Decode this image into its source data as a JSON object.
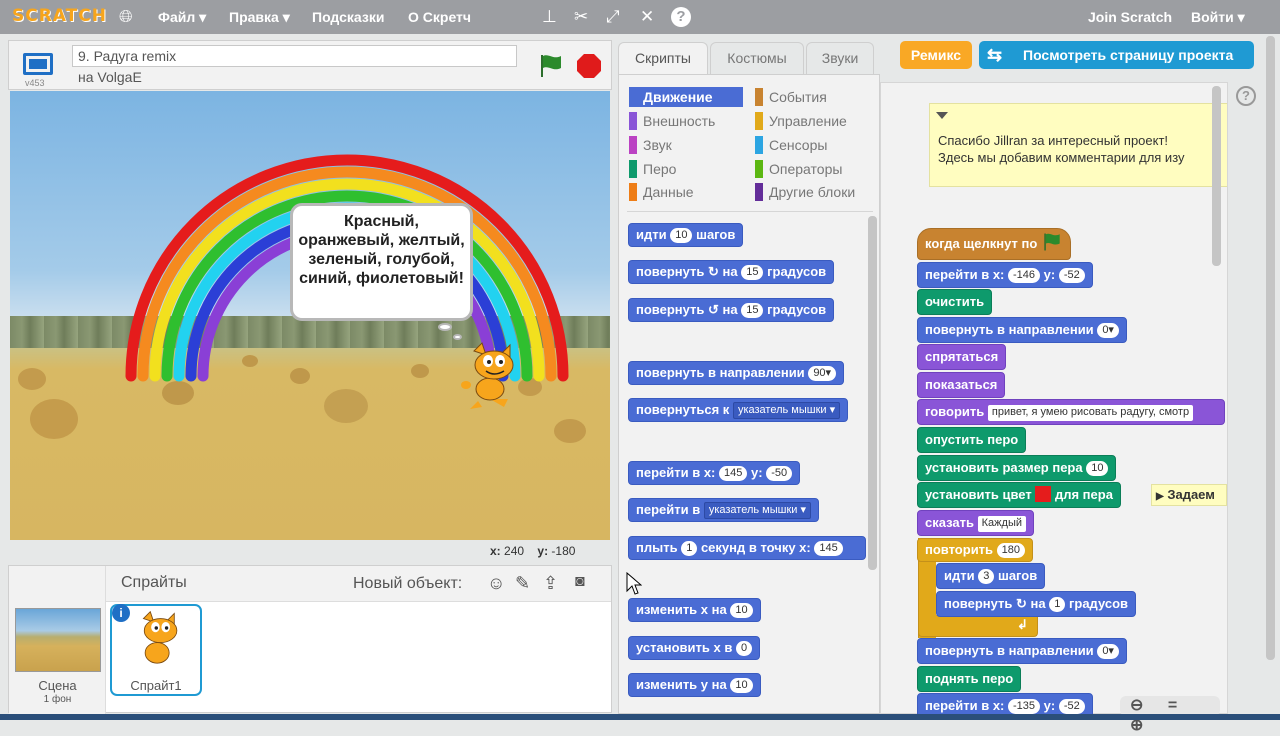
{
  "topbar": {
    "logo": "SCRATCH",
    "menus": [
      "Файл ▾",
      "Правка ▾",
      "Подсказки",
      "О Скретч"
    ],
    "join": "Join Scratch",
    "login": "Войти ▾",
    "tool_icons": [
      "globe-icon",
      "stamp-icon",
      "cut-icon",
      "grow-icon",
      "shrink-icon",
      "help-icon"
    ]
  },
  "stage": {
    "version": "v453",
    "project_title": "9. Радуга remix",
    "author": "на VolgaE",
    "bubble_text": "Красный, оранжевый, желтый, зеленый, голубой, синий, фиолетовый!",
    "coords_x_label": "x:",
    "coords_x": "240",
    "coords_y_label": "y:",
    "coords_y": "-180",
    "rainbow_colors": [
      "#e51c1c",
      "#f58a1f",
      "#f2e01e",
      "#2fbf2f",
      "#22d2f0",
      "#2b3fd6",
      "#8a3fd6"
    ],
    "flag_color": "#2c8a2c",
    "stop_color": "#e01b1b"
  },
  "sprites": {
    "header": "Спрайты",
    "new_object": "Новый объект:",
    "tools": [
      "☺",
      "✎",
      "⇪",
      "📷"
    ],
    "scene_label": "Сцена",
    "scene_sub": "1 фон",
    "sprite_label": "Спрайт1",
    "info_badge": "i"
  },
  "tabs": {
    "scripts": "Скрипты",
    "costumes": "Костюмы",
    "sounds": "Звуки",
    "remix": "Ремикс",
    "see_project": "Посмотреть страницу проекта"
  },
  "categories": {
    "left": [
      {
        "label": "Движение",
        "color": "#4a6cd4"
      },
      {
        "label": "Внешность",
        "color": "#8a55d7"
      },
      {
        "label": "Звук",
        "color": "#bb42c3"
      },
      {
        "label": "Перо",
        "color": "#0e9a6c"
      },
      {
        "label": "Данные",
        "color": "#ee7d16"
      }
    ],
    "right": [
      {
        "label": "События",
        "color": "#c88330"
      },
      {
        "label": "Управление",
        "color": "#e1a91a"
      },
      {
        "label": "Сенсоры",
        "color": "#2ca5e2"
      },
      {
        "label": "Операторы",
        "color": "#5cb712"
      },
      {
        "label": "Другие блоки",
        "color": "#632d99"
      }
    ]
  },
  "palette": {
    "b1": {
      "pre": "идти",
      "v": "10",
      "post": "шагов"
    },
    "b2": {
      "pre": "повернуть ↻ на",
      "v": "15",
      "post": "градусов"
    },
    "b3": {
      "pre": "повернуть ↺ на",
      "v": "15",
      "post": "градусов"
    },
    "b4": {
      "pre": "повернуть в направлении",
      "v": "90▾"
    },
    "b5": {
      "pre": "повернуться к",
      "v": "указатель мышки ▾"
    },
    "b6": {
      "pre": "перейти в x:",
      "v": "145",
      "mid": "y:",
      "v2": "-50"
    },
    "b7": {
      "pre": "перейти в",
      "v": "указатель мышки ▾"
    },
    "b8": {
      "pre": "плыть",
      "v": "1",
      "mid": "секунд в точку x:",
      "v2": "145"
    },
    "b9": {
      "pre": "изменить х на",
      "v": "10"
    },
    "b10": {
      "pre": "установить х в",
      "v": "0"
    },
    "b11": {
      "pre": "изменить у на",
      "v": "10"
    }
  },
  "script": {
    "comment_line1": "Спасибо Jillran за интересный проект!",
    "comment_line2": "Здесь мы добавим комментарии для изу",
    "hat": "когда щелкнут по",
    "s1": {
      "pre": "перейти в x:",
      "v": "-146",
      "mid": "y:",
      "v2": "-52"
    },
    "s2": "очистить",
    "s3": {
      "pre": "повернуть в направлении",
      "v": "0▾"
    },
    "s4": "спрятаться",
    "s5": "показаться",
    "s6": {
      "pre": "говорить",
      "v": "привет, я умею рисовать радугу, смотр"
    },
    "s7": "опустить перо",
    "s8": {
      "pre": "установить размер пера",
      "v": "10"
    },
    "s9": {
      "pre": "установить цвет",
      "post": "для пера"
    },
    "s9_note": "Задаем",
    "s10": {
      "pre": "сказать",
      "v": "Каждый"
    },
    "s11": {
      "pre": "повторить",
      "v": "180"
    },
    "s12": {
      "pre": "идти",
      "v": "3",
      "post": "шагов"
    },
    "s13": {
      "pre": "повернуть ↻ на",
      "v": "1",
      "post": "градусов"
    },
    "s14": {
      "pre": "повернуть в направлении",
      "v": "0▾"
    },
    "s15": "поднять перо",
    "s16": {
      "pre": "перейти в x:",
      "v": "-135",
      "mid": "y:",
      "v2": "-52"
    },
    "zoom": "⊖ = ⊕",
    "help": "?"
  }
}
